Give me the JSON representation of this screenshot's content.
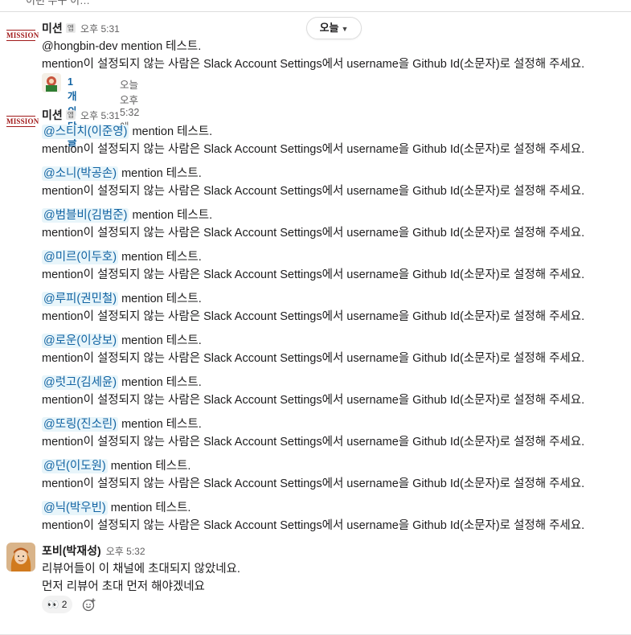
{
  "top_clipped_text": "이런 누구 이…",
  "date_divider": {
    "label": "오늘"
  },
  "messages": [
    {
      "sender": "미션",
      "badge": "앱",
      "time": "오후 5:31",
      "avatar": "MISSION",
      "lines": [
        {
          "mention": "",
          "text": "@hongbin-dev mention 테스트."
        },
        {
          "mention": "",
          "text": "mention이 설정되지 않는 사람은 Slack Account Settings에서 username을 Github Id(소문자)로 설정해 주세요."
        }
      ],
      "thread": {
        "replies": "1개의 답글",
        "last_reply": "오늘 오후 5:32에"
      }
    },
    {
      "sender": "미션",
      "badge": "앱",
      "time": "오후 5:31",
      "avatar": "MISSION",
      "entries": [
        {
          "mention": "@스티치(이준영)",
          "suffix": " mention 테스트."
        },
        {
          "mention": "@소니(박공손)",
          "suffix": " mention 테스트."
        },
        {
          "mention": "@범블비(김범준)",
          "suffix": " mention 테스트."
        },
        {
          "mention": "@미르(이두호)",
          "suffix": " mention 테스트."
        },
        {
          "mention": "@루피(권민철)",
          "suffix": " mention 테스트."
        },
        {
          "mention": "@로운(이상보)",
          "suffix": " mention 테스트."
        },
        {
          "mention": "@럿고(김세윤)",
          "suffix": " mention 테스트."
        },
        {
          "mention": "@또링(진소린)",
          "suffix": " mention 테스트."
        },
        {
          "mention": "@던(이도원)",
          "suffix": " mention 테스트."
        },
        {
          "mention": "@닉(박우빈)",
          "suffix": " mention 테스트."
        }
      ],
      "instruction": "mention이 설정되지 않는 사람은 Slack Account Settings에서 username을 Github Id(소문자)로 설정해 주세요."
    },
    {
      "sender": "포비(박재성)",
      "time": "오후 5:32",
      "lines": [
        {
          "text": "리뷰어들이 이 채널에 초대되지 않았네요."
        },
        {
          "text": "먼저 리뷰어 초대 먼저 해야겠네요"
        }
      ],
      "reactions": [
        {
          "emoji": "👀",
          "count": "2"
        }
      ]
    }
  ],
  "colors": {
    "mention_bg": "#e8f5fa",
    "mention_fg": "#1264a3",
    "link": "#1264a3"
  }
}
